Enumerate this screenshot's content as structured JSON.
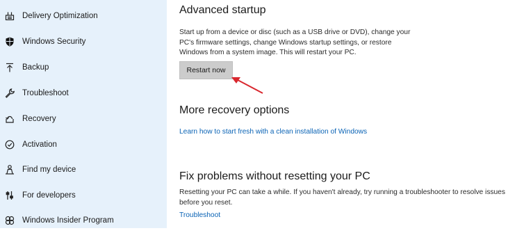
{
  "sidebar": {
    "items": [
      {
        "label": "Delivery Optimization",
        "icon": "delivery-optimization-icon"
      },
      {
        "label": "Windows Security",
        "icon": "shield-icon"
      },
      {
        "label": "Backup",
        "icon": "backup-arrow-icon"
      },
      {
        "label": "Troubleshoot",
        "icon": "wrench-icon"
      },
      {
        "label": "Recovery",
        "icon": "recovery-icon"
      },
      {
        "label": "Activation",
        "icon": "activation-check-icon"
      },
      {
        "label": "Find my device",
        "icon": "person-location-icon"
      },
      {
        "label": "For developers",
        "icon": "developer-sliders-icon"
      },
      {
        "label": "Windows Insider Program",
        "icon": "insider-program-icon"
      }
    ]
  },
  "advanced_startup": {
    "title": "Advanced startup",
    "lines": [
      "Start up from a device or disc (such as a USB drive or DVD), change your",
      "PC's firmware settings, change Windows startup settings, or restore",
      "Windows from a system image. This will restart your PC."
    ],
    "button_label": "Restart now"
  },
  "more_recovery": {
    "title": "More recovery options",
    "link": "Learn how to start fresh with a clean installation of Windows"
  },
  "fix_problems": {
    "title": "Fix problems without resetting your PC",
    "lines": [
      "Resetting your PC can take a while. If you haven't already, try running a troubleshooter to resolve issues",
      "before you reset."
    ],
    "link": "Troubleshoot"
  },
  "colors": {
    "sidebar_bg": "#e6f1fb",
    "link": "#0a63b5",
    "annotation_arrow": "#d9272e",
    "button_bg": "#cccccc"
  }
}
